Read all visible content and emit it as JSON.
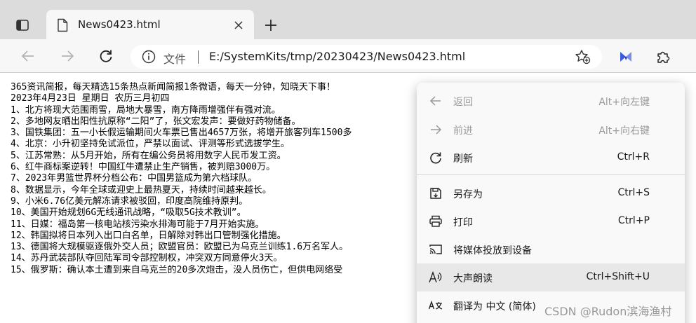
{
  "tab": {
    "title": "News0423.html"
  },
  "toolbar": {
    "scheme_label": "文件",
    "url": "E:/SystemKits/tmp/20230423/News0423.html"
  },
  "content": {
    "lines": [
      "365资讯简报，每天精选15条热点新闻简报1条微语，每天一分钟，知晓天下事！",
      "2023年4月23日  星期日  农历三月初四",
      "1、北方将现大范围雨雪，局地大暴雪，南方降雨增强伴有强对流。",
      "2、多地网友晒出阳性抗原称“二阳”了，张文宏发声：要做好药物储备。",
      "3、国铁集团：五一小长假运输期间火车票已售出4657万张，将增开旅客列车1500多",
      "4、北京：小升初坚持免试派位，严禁以面试、评测等形式选拔学生。",
      "5、江苏常熟：从5月开始，所有在编公务员将用数字人民币发工资。",
      "6、红牛商标案逆转！中国红牛遭禁止生产销售，被判赔3000万。",
      "7、2023年男篮世界杯分档公布：中国男篮成为第六档球队。",
      "8、数据显示，今年全球或迎史上最热夏天，持续时间越来越长。",
      "9、小米6.76亿美元解冻请求被驳回，印度高院维持原判。",
      "10、美国开始规划6G无线通讯战略，“吸取5G技术教训”。",
      "11、日媒：福岛第一核电站核污染水排海可能于7月开始实施。",
      "12、韩国拟将日本列入出口白名单，日解除对韩出口管制强化措施。",
      "13、德国将大规模驱逐俄外交人员；欧盟官员：欧盟已为乌克兰训练1.6万名军人。",
      "14、苏丹武装部队夺回陆军司令部控制权，冲突双方同意停火3天。",
      "15、俄罗斯：确认本土遭到来自乌克兰的20多次炮击，没人员伤亡，但供电网络受"
    ]
  },
  "context_menu": {
    "back": {
      "label": "返回",
      "shortcut": "Alt+向左键"
    },
    "forward": {
      "label": "前进",
      "shortcut": "Alt+向右键"
    },
    "refresh": {
      "label": "刷新",
      "shortcut": "Ctrl+R"
    },
    "save_as": {
      "label": "另存为",
      "shortcut": "Ctrl+S"
    },
    "print": {
      "label": "打印",
      "shortcut": "Ctrl+P"
    },
    "cast": {
      "label": "将媒体投放到设备"
    },
    "read_aloud": {
      "label": "大声朗读",
      "shortcut": "Ctrl+Shift+U"
    },
    "translate": {
      "label": "翻译为 中文 (简体)"
    }
  },
  "watermark": "CSDN @Rudon滨海渔村",
  "colors": {
    "tabstrip": "#dcdcdc",
    "toolbar": "#f7f7f7",
    "menu_highlight": "#e8e8e8",
    "extension_accent": "#3b5bdb"
  }
}
